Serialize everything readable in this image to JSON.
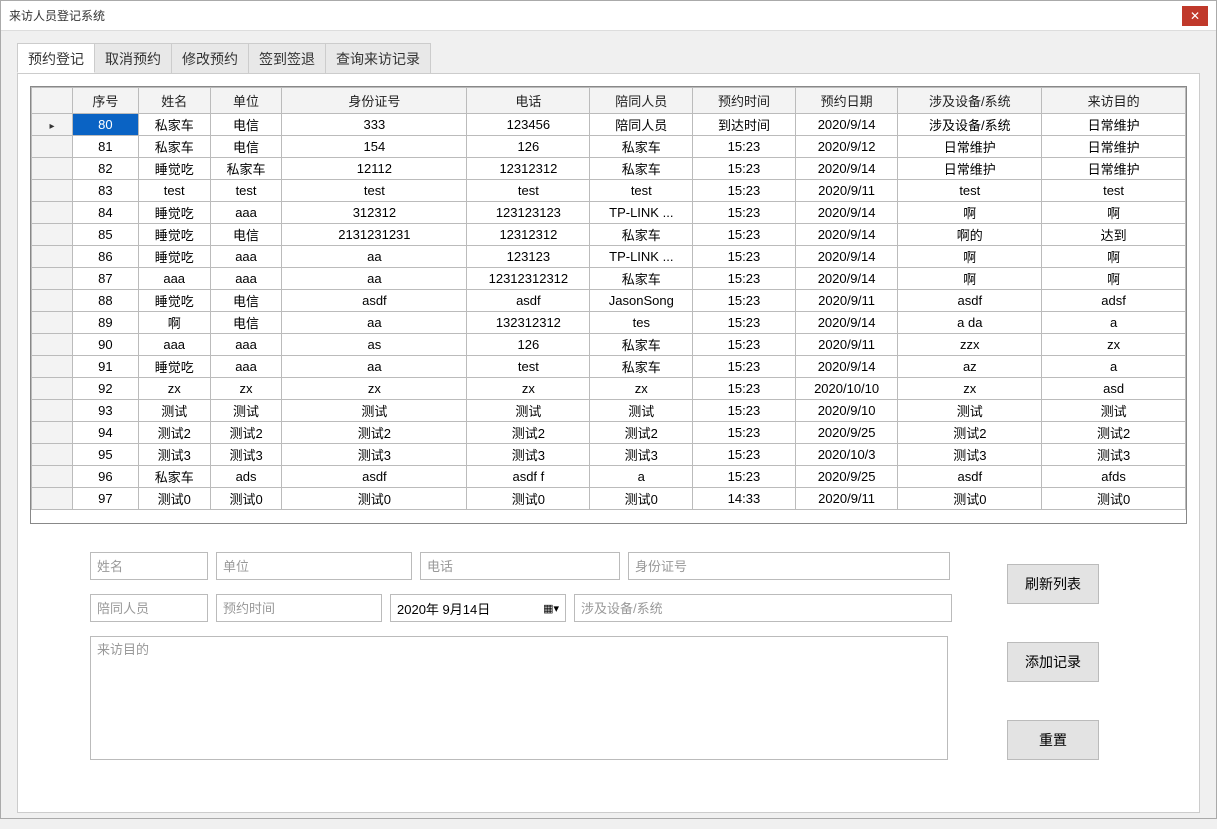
{
  "window": {
    "title": "来访人员登记系统"
  },
  "tabs": [
    {
      "label": "预约登记"
    },
    {
      "label": "取消预约"
    },
    {
      "label": "修改预约"
    },
    {
      "label": "签到签退"
    },
    {
      "label": "查询来访记录"
    }
  ],
  "grid": {
    "columns": [
      "序号",
      "姓名",
      "单位",
      "身份证号",
      "电话",
      "陪同人员",
      "预约时间",
      "预约日期",
      "涉及设备/系统",
      "来访目的"
    ],
    "widths": [
      64,
      70,
      70,
      180,
      120,
      100,
      100,
      100,
      140,
      140
    ],
    "rows": [
      [
        "80",
        "私家车",
        "电信",
        "333",
        "123456",
        "陪同人员",
        "到达时间",
        "2020/9/14",
        "涉及设备/系统",
        "日常维护"
      ],
      [
        "81",
        "私家车",
        "电信",
        "154",
        "126",
        "私家车",
        "15:23",
        "2020/9/12",
        "日常维护",
        "日常维护"
      ],
      [
        "82",
        "睡觉吃",
        "私家车",
        "12112",
        "12312312",
        "私家车",
        "15:23",
        "2020/9/14",
        "日常维护",
        "日常维护"
      ],
      [
        "83",
        "test",
        "test",
        "test",
        "test",
        "test",
        "15:23",
        "2020/9/11",
        "test",
        "test"
      ],
      [
        "84",
        "睡觉吃",
        "aaa",
        "312312",
        "123123123",
        "TP-LINK ...",
        "15:23",
        "2020/9/14",
        "啊",
        "啊"
      ],
      [
        "85",
        "睡觉吃",
        "电信",
        "2131231231",
        "12312312",
        "私家车",
        "15:23",
        "2020/9/14",
        "啊的",
        "达到"
      ],
      [
        "86",
        "睡觉吃",
        "aaa",
        "aa",
        "123123",
        "TP-LINK ...",
        "15:23",
        "2020/9/14",
        "啊",
        "啊"
      ],
      [
        "87",
        "aaa",
        "aaa",
        "aa",
        "12312312312",
        "私家车",
        "15:23",
        "2020/9/14",
        "啊",
        "啊"
      ],
      [
        "88",
        "睡觉吃",
        "电信",
        "asdf",
        "asdf",
        "JasonSong",
        "15:23",
        "2020/9/11",
        "asdf",
        "adsf"
      ],
      [
        "89",
        "啊",
        "电信",
        "aa",
        "132312312",
        "tes",
        "15:23",
        "2020/9/14",
        "a da",
        "a"
      ],
      [
        "90",
        "aaa",
        "aaa",
        "as",
        "126",
        "私家车",
        "15:23",
        "2020/9/11",
        "zzx",
        "zx"
      ],
      [
        "91",
        "睡觉吃",
        "aaa",
        "aa",
        "test",
        "私家车",
        "15:23",
        "2020/9/14",
        "az",
        "a"
      ],
      [
        "92",
        "zx",
        "zx",
        "zx",
        "zx",
        "zx",
        "15:23",
        "2020/10/10",
        "zx",
        "asd"
      ],
      [
        "93",
        "测试",
        "测试",
        "测试",
        "测试",
        "测试",
        "15:23",
        "2020/9/10",
        "测试",
        "测试"
      ],
      [
        "94",
        "测试2",
        "测试2",
        "测试2",
        "测试2",
        "测试2",
        "15:23",
        "2020/9/25",
        "测试2",
        "测试2"
      ],
      [
        "95",
        "测试3",
        "测试3",
        "测试3",
        "测试3",
        "测试3",
        "15:23",
        "2020/10/3",
        "测试3",
        "测试3"
      ],
      [
        "96",
        "私家车",
        "ads",
        "asdf",
        "asdf f",
        "a",
        "15:23",
        "2020/9/25",
        "asdf",
        "afds"
      ],
      [
        "97",
        "测试0",
        "测试0",
        "测试0",
        "测试0",
        "测试0",
        "14:33",
        "2020/9/11",
        "测试0",
        "测试0"
      ]
    ],
    "selected_row": 0
  },
  "form": {
    "name_ph": "姓名",
    "unit_ph": "单位",
    "phone_ph": "电话",
    "idno_ph": "身份证号",
    "companion_ph": "陪同人员",
    "appttime_ph": "预约时间",
    "date_value": "2020年  9月14日",
    "equip_ph": "涉及设备/系统",
    "purpose_ph": "来访目的"
  },
  "buttons": {
    "refresh": "刷新列表",
    "add": "添加记录",
    "reset": "重置"
  }
}
